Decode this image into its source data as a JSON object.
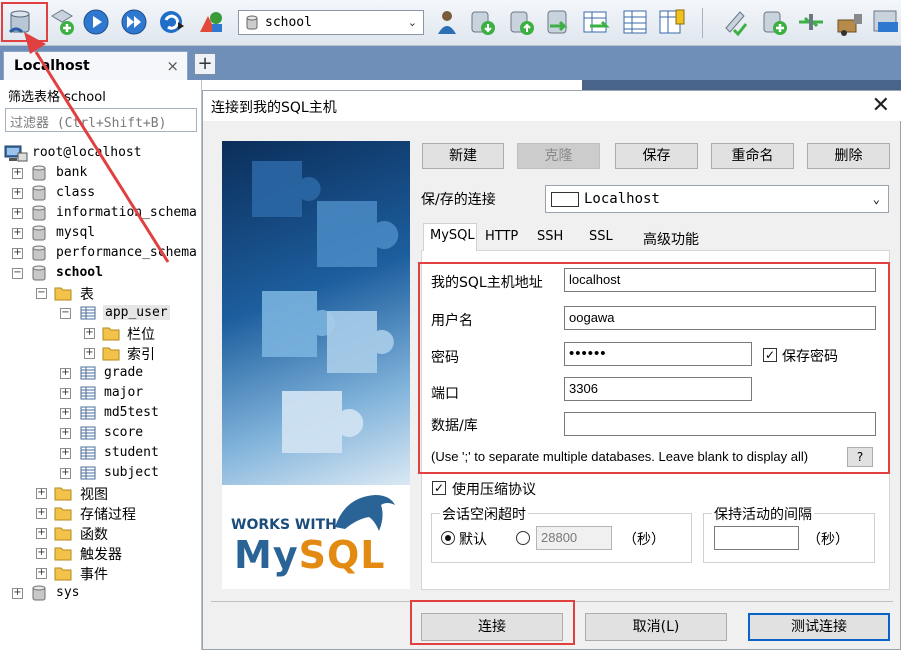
{
  "toolbar": {
    "db_select_value": "school"
  },
  "tabs": {
    "connection_tab": "Localhost",
    "close_glyph": "×",
    "add_glyph": "+"
  },
  "sidebar": {
    "filter_label": "筛选表格 school",
    "filter_placeholder": "过滤器 (Ctrl+Shift+B)",
    "root": "root@localhost",
    "databases": [
      "bank",
      "class",
      "information_schema",
      "mysql",
      "performance_schema"
    ],
    "school": {
      "name": "school",
      "tables_folder": "表",
      "app_user": "app_user",
      "app_user_children": [
        "栏位",
        "索引"
      ],
      "tables": [
        "grade",
        "major",
        "md5test",
        "score",
        "student",
        "subject"
      ],
      "folders": [
        "视图",
        "存储过程",
        "函数",
        "触发器",
        "事件"
      ]
    },
    "sys": "sys"
  },
  "dialog": {
    "title": "连接到我的SQL主机",
    "close_glyph": "✕",
    "logo_works_with": "WORKS WITH",
    "logo_my": "My",
    "logo_sql": "SQL",
    "buttons": {
      "new": "新建",
      "clone": "克隆",
      "save": "保存",
      "rename": "重命名",
      "delete": "删除"
    },
    "saved_label": "保/存的连接",
    "saved_value": "Localhost",
    "conn_tabs": [
      "MySQL",
      "HTTP",
      "SSH",
      "SSL",
      "高级功能"
    ],
    "form": {
      "host_label": "我的SQL主机地址",
      "host_value": "localhost",
      "user_label": "用户名",
      "user_value": "oogawa",
      "password_label": "密码",
      "password_value": "••••••",
      "save_password_label": "保存密码",
      "port_label": "端口",
      "port_value": "3306",
      "database_label": "数据/库",
      "database_value": "",
      "hint": "(Use ';' to separate multiple databases. Leave blank to display all)",
      "help_label": "?"
    },
    "compression_label": "使用压缩协议",
    "session_timeout": {
      "label": "会话空闲超时",
      "default_label": "默认",
      "value": "28800",
      "unit": "（秒）"
    },
    "keepalive": {
      "label": "保持活动的间隔",
      "value": "",
      "unit": "（秒）"
    },
    "footer": {
      "connect": "连接",
      "cancel": "取消(L)",
      "test": "测试连接"
    }
  }
}
